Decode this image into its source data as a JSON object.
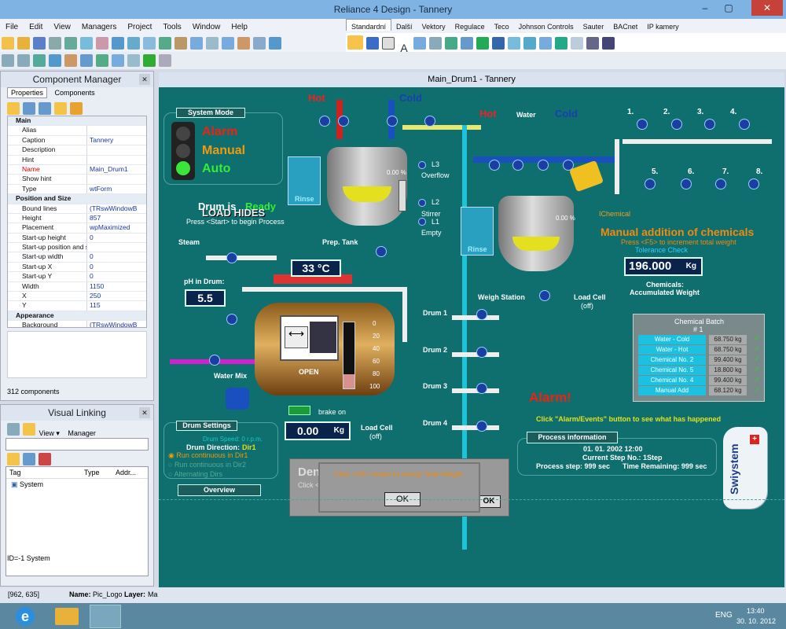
{
  "window": {
    "title": "Reliance 4 Design - Tannery"
  },
  "menu": [
    "File",
    "Edit",
    "View",
    "Managers",
    "Project",
    "Tools",
    "Window",
    "Help"
  ],
  "toolbar_tabs": [
    "Standardní",
    "Další",
    "Vektory",
    "Regulace",
    "Teco",
    "Johnson Controls",
    "Sauter",
    "BACnet",
    "IP kamery"
  ],
  "component_manager": {
    "title": "Component Manager",
    "tabs": [
      "Properties",
      "Components"
    ],
    "rows": [
      {
        "k": "Main",
        "v": "",
        "sec": true
      },
      {
        "k": "Alias",
        "v": ""
      },
      {
        "k": "Caption",
        "v": "Tannery"
      },
      {
        "k": "Description",
        "v": ""
      },
      {
        "k": "Hint",
        "v": ""
      },
      {
        "k": "Name",
        "v": "Main_Drum1",
        "sel": true
      },
      {
        "k": "Show hint",
        "v": ""
      },
      {
        "k": "Type",
        "v": "wtForm"
      },
      {
        "k": "Position and Size",
        "v": "",
        "sec": true
      },
      {
        "k": "Bound lines",
        "v": "(TRswWindowB"
      },
      {
        "k": "Height",
        "v": "857"
      },
      {
        "k": "Placement",
        "v": "wpMaximized"
      },
      {
        "k": "Start-up height",
        "v": "0"
      },
      {
        "k": "Start-up position and s",
        "v": ""
      },
      {
        "k": "Start-up width",
        "v": "0"
      },
      {
        "k": "Start-up X",
        "v": "0"
      },
      {
        "k": "Start-up Y",
        "v": "0"
      },
      {
        "k": "Width",
        "v": "1150"
      },
      {
        "k": "X",
        "v": "250"
      },
      {
        "k": "Y",
        "v": "115"
      },
      {
        "k": "Appearance",
        "v": "",
        "sec": true
      },
      {
        "k": "Background",
        "v": "(TRswWindowB"
      }
    ],
    "count": "312 components"
  },
  "visual_linking": {
    "title": "Visual Linking",
    "view_label": "View",
    "manager_label": "Manager",
    "cols": [
      "Tag",
      "Type",
      "Addr..."
    ],
    "item": "System",
    "footer": "ID=-1   System"
  },
  "statusbar": {
    "coords": "[962, 635]",
    "name_label": "Name:",
    "name": "Pic_Logo",
    "layer_label": "Layer:",
    "layer": "Ma"
  },
  "taskbar": {
    "lang": "ENG",
    "time": "13:40",
    "date": "30. 10. 2012"
  },
  "scada": {
    "window_title": "Main_Drum1 - Tannery",
    "system_mode": "System Mode",
    "modes": [
      "Alarm",
      "Manual",
      "Auto"
    ],
    "hot": "Hot",
    "cold": "Cold",
    "water": "Water",
    "drum_is": "Drum is",
    "ready": "Ready",
    "load_hides": "LOAD HIDES",
    "press_start": "Press <Start> to begin Process",
    "rinse": "Rinse",
    "prep_tank": "Prep. Tank",
    "pct": "0.00 %",
    "l3": "L3",
    "overflow": "Overflow",
    "l2": "L2",
    "stirrer": "Stirrer",
    "l1": "L1",
    "empty": "Empty",
    "steam": "Steam",
    "temp": "33 °C",
    "ph_label": "pH in Drum:",
    "ph": "5.5",
    "water_mix": "Water Mix",
    "open": "OPEN",
    "scale": [
      "0",
      "20",
      "40",
      "60",
      "80",
      "100"
    ],
    "brake_on": "brake on",
    "load_cell": "Load Cell",
    "off": "(off)",
    "drum_settings": "Drum Settings",
    "drum_speed": "Drum Speed: 0 r.p.m.",
    "drum_direction": "Drum Direction:",
    "dir": "Dir1",
    "radio": [
      "Run continuous in Dir1",
      "Run continuous in Dir2",
      "Alternating Dirs"
    ],
    "overview": "Overview",
    "weight_drum": "0.00",
    "kg": "Kg",
    "drums": [
      "Drum 1",
      "Drum 2",
      "Drum 3",
      "Drum 4"
    ],
    "weigh_station": "Weigh Station",
    "ichemical": "IChemical",
    "manual_add": "Manual addition of chemicals",
    "press_f5": "Press <F5> to increment total weight",
    "tolerance": "Tolerance Check",
    "weight_total": "196.000",
    "chem_label": "Chemicals:",
    "acc": "Accumulated Weight",
    "numbers": [
      "1.",
      "2.",
      "3.",
      "4.",
      "5.",
      "6.",
      "7.",
      "8."
    ],
    "alarm": "Alarm!",
    "click_alarm": "Click \"Alarm/Events\" button to see what has happened",
    "chem_batch": "Chemical Batch",
    "batch_no": "# 1",
    "batch": [
      {
        "n": "Water - Cold",
        "w": "68.750 kg"
      },
      {
        "n": "Water - Hot",
        "w": "68.750 kg"
      },
      {
        "n": "Chemical No. 2",
        "w": "99.400 kg"
      },
      {
        "n": "Chemical No. 5",
        "w": "18.800 kg"
      },
      {
        "n": "Chemical No. 4",
        "w": "99.400 kg"
      },
      {
        "n": "Manual Add",
        "w": "68.120 kg"
      }
    ],
    "process_info": "Process information",
    "proc_date": "01. 01. 2002  12:00",
    "current_step": "Current Step No.: 1Step",
    "process_step": "Process step: 999 sec",
    "time_remaining": "Time Remaining: 999 sec",
    "dialog_title": "Den",
    "dialog_text": "Click <OK> button to accept Total Weight",
    "dialog_click": "Click <",
    "ok": "OK",
    "logo": "Swiystem"
  }
}
